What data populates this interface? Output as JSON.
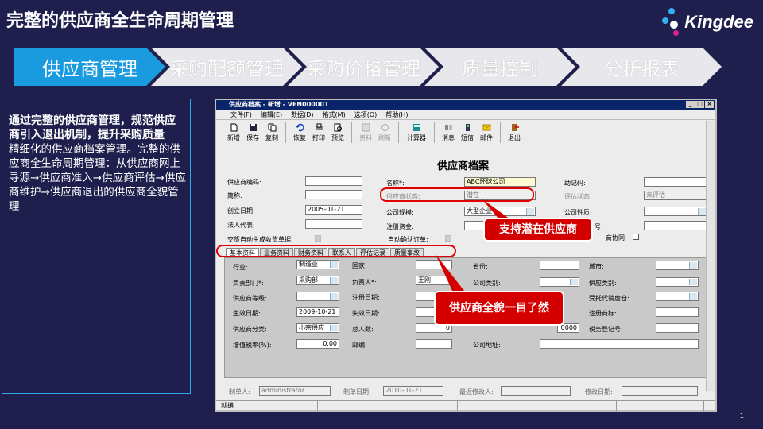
{
  "slide": {
    "title": "完整的供应商全生命周期管理",
    "logo_text": "Kingdee",
    "page_number": "1"
  },
  "process_steps": [
    {
      "label": "供应商管理",
      "active": true
    },
    {
      "label": "采购配额管理",
      "active": false
    },
    {
      "label": "采购价格管理",
      "active": false
    },
    {
      "label": "质量控制",
      "active": false
    },
    {
      "label": "分析报表",
      "active": false
    }
  ],
  "left_panel": {
    "heading": "通过完整的供应商管理，规范供应商引入退出机制，提升采购质量",
    "body": "精细化的供应商档案管理。完整的供应商全生命周期管理：从供应商网上寻源→供应商准入→供应商评估→供应商维护→供应商退出的供应商全貌管理"
  },
  "window": {
    "title": "供应商档案 - 新增 - VEN000001",
    "controls": [
      "_",
      "□",
      "×"
    ],
    "menu": [
      "文件(F)",
      "编辑(E)",
      "数据(D)",
      "格式(M)",
      "选项(O)",
      "帮助(H)"
    ],
    "toolbar": [
      {
        "label": "新增",
        "icon": "new-doc-icon",
        "enabled": true
      },
      {
        "label": "保存",
        "icon": "save-icon",
        "enabled": true
      },
      {
        "label": "复制",
        "icon": "copy-icon",
        "enabled": true
      },
      {
        "label": "恢复",
        "icon": "undo-icon",
        "enabled": true
      },
      {
        "label": "打印",
        "icon": "print-icon",
        "enabled": true
      },
      {
        "label": "预览",
        "icon": "preview-icon",
        "enabled": true
      },
      {
        "label": "资料",
        "icon": "data-icon",
        "enabled": false
      },
      {
        "label": "刷新",
        "icon": "refresh-icon",
        "enabled": false
      },
      {
        "label": "计算器",
        "icon": "calculator-icon",
        "enabled": true
      },
      {
        "label": "消息",
        "icon": "message-icon",
        "enabled": true
      },
      {
        "label": "短信",
        "icon": "sms-icon",
        "enabled": true
      },
      {
        "label": "邮件",
        "icon": "mail-icon",
        "enabled": true
      },
      {
        "label": "退出",
        "icon": "exit-icon",
        "enabled": true
      }
    ],
    "form_title": "供应商档案",
    "header_fields": {
      "supplier_code_label": "供应商编码:",
      "name_label": "名称*:",
      "name_value": "ABC环球公司",
      "mnemonic_label": "助记码:",
      "short_name_label": "简称:",
      "status_label": "供应商状态:",
      "status_value": "潜在",
      "eval_status_label": "评估状态:",
      "eval_status_value": "未评估",
      "created_date_label": "创立日期:",
      "created_date_value": "2005-01-21",
      "scale_label": "公司规模:",
      "scale_value": "大型企业",
      "nature_label": "公司性质:",
      "legal_rep_label": "法人代表:",
      "capital_label": "注册资金:",
      "reg_no_label": "号:",
      "auto_ship_label": "交货自动生成收货单据:",
      "auto_confirm_label": "自动确认订单:",
      "collab_label": "商协同:"
    },
    "tabs": [
      "基本资料",
      "业务资料",
      "财务资料",
      "联系人",
      "评估记录",
      "质量事故"
    ],
    "basic_fields": {
      "industry_label": "行业:",
      "industry_value": "制造业",
      "country_label": "国家:",
      "province_label": "省份:",
      "city_label": "城市:",
      "dept_label": "负责部门*:",
      "dept_value": "采购部",
      "owner_label": "负责人*:",
      "owner_value": "王刚",
      "company_type_label": "公司类别:",
      "supplier_type_label": "供应类别:",
      "level_label": "供应商等级:",
      "reg_date_label": "注册日期:",
      "warehouse_label": "受托代销虚仓:",
      "effective_date_label": "生效日期:",
      "effective_date_value": "2009-10-21",
      "expire_date_label": "失效日期:",
      "trademark_label": "注册商标:",
      "category_label": "供应商分类:",
      "category_value": "小宗供应",
      "total_label": "总人数:",
      "total_value": "0",
      "capital_value": "0000",
      "tax_reg_label": "税务登记号:",
      "vat_label": "增值税率(%):",
      "vat_value": "0.00",
      "zip_label": "邮编:",
      "address_label": "公司地址:"
    },
    "footer_fields": {
      "creator_label": "制单人:",
      "creator_value": "administrator",
      "create_date_label": "制单日期:",
      "create_date_value": "2010-01-21",
      "modifier_label": "最近修改人:",
      "modify_date_label": "修改日期:"
    },
    "status_text": "就绪"
  },
  "callouts": {
    "potential": "支持潜在供应商",
    "overview": "供应商全貌一目了然"
  },
  "colors": {
    "background": "#1f1f4d",
    "active_step": "#1a9be0",
    "callout": "#d40000",
    "titlebar": "#0a246a"
  }
}
